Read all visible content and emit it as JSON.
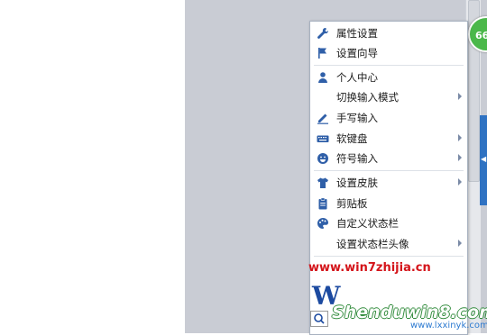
{
  "menu": {
    "items": [
      {
        "label": "属性设置",
        "icon": "wrench-icon",
        "submenu": false
      },
      {
        "label": "设置向导",
        "icon": "flag-icon",
        "submenu": false
      },
      {
        "label": "个人中心",
        "icon": "user-icon",
        "submenu": false
      },
      {
        "label": "切换输入模式",
        "icon": "",
        "submenu": true
      },
      {
        "label": "手写输入",
        "icon": "pen-icon",
        "submenu": false
      },
      {
        "label": "软键盘",
        "icon": "keyboard-icon",
        "submenu": true
      },
      {
        "label": "符号输入",
        "icon": "smiley-icon",
        "submenu": true
      },
      {
        "label": "设置皮肤",
        "icon": "shirt-icon",
        "submenu": true
      },
      {
        "label": "剪贴板",
        "icon": "clipboard-icon",
        "submenu": false
      },
      {
        "label": "自定义状态栏",
        "icon": "palette-icon",
        "submenu": false
      },
      {
        "label": "设置状态栏头像",
        "icon": "",
        "submenu": true
      }
    ]
  },
  "badge": {
    "text": "66"
  },
  "watermark": {
    "url": "www.win7zhijia.cn",
    "logo_letter": "W",
    "brand": "Shenduwin8.com",
    "site": "www.lxxinyk.com"
  },
  "colors": {
    "accent": "#2f72c2",
    "icon_blue": "#2f5fa8",
    "badge_green": "#4bb84a"
  }
}
